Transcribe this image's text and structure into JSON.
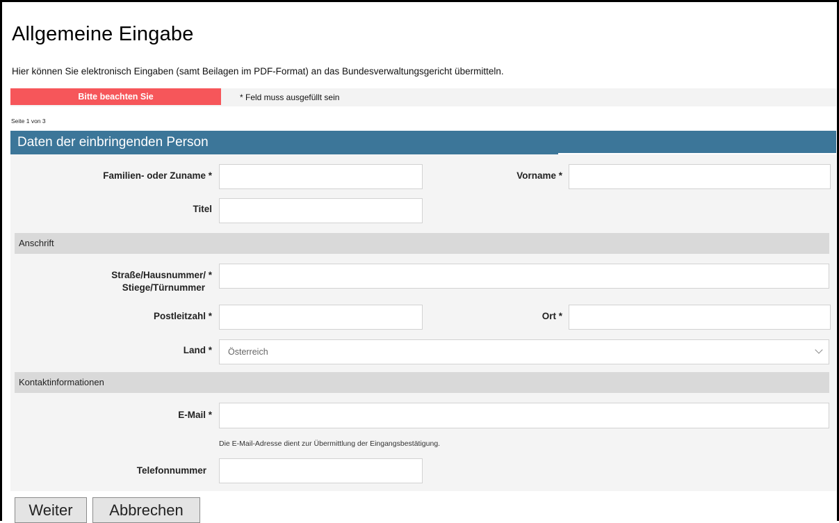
{
  "page": {
    "title": "Allgemeine Eingabe",
    "intro": "Hier können Sie elektronisch Eingaben (samt Beilagen im PDF-Format) an das Bundesverwaltungsgericht übermitteln.",
    "notice_label": "Bitte beachten Sie",
    "required_note": "* Feld muss ausgefüllt sein",
    "page_indicator": "Seite 1 von 3"
  },
  "section": {
    "title": "Daten der einbringenden Person"
  },
  "fields": {
    "lastname": {
      "label": "Familien- oder Zuname *",
      "value": ""
    },
    "firstname": {
      "label": "Vorname *",
      "value": ""
    },
    "title": {
      "label": "Titel",
      "value": ""
    },
    "street": {
      "label_line1": "Straße/Hausnummer/ *",
      "label_line2": "Stiege/Türnummer",
      "value": ""
    },
    "postcode": {
      "label": "Postleitzahl *",
      "value": ""
    },
    "city": {
      "label": "Ort *",
      "value": ""
    },
    "country": {
      "label": "Land *",
      "value": "Österreich"
    },
    "email": {
      "label": "E-Mail *",
      "value": "",
      "hint": "Die E-Mail-Adresse dient zur Übermittlung der Eingangsbestätigung."
    },
    "phone": {
      "label": "Telefonnummer",
      "value": ""
    }
  },
  "subsections": {
    "address": "Anschrift",
    "contact": "Kontaktinformationen"
  },
  "buttons": {
    "next": "Weiter",
    "cancel": "Abbrechen"
  },
  "colors": {
    "section_header": "#3c7699",
    "notice": "#f6565a",
    "panel": "#f4f4f4",
    "subheader": "#d9d9d9"
  }
}
